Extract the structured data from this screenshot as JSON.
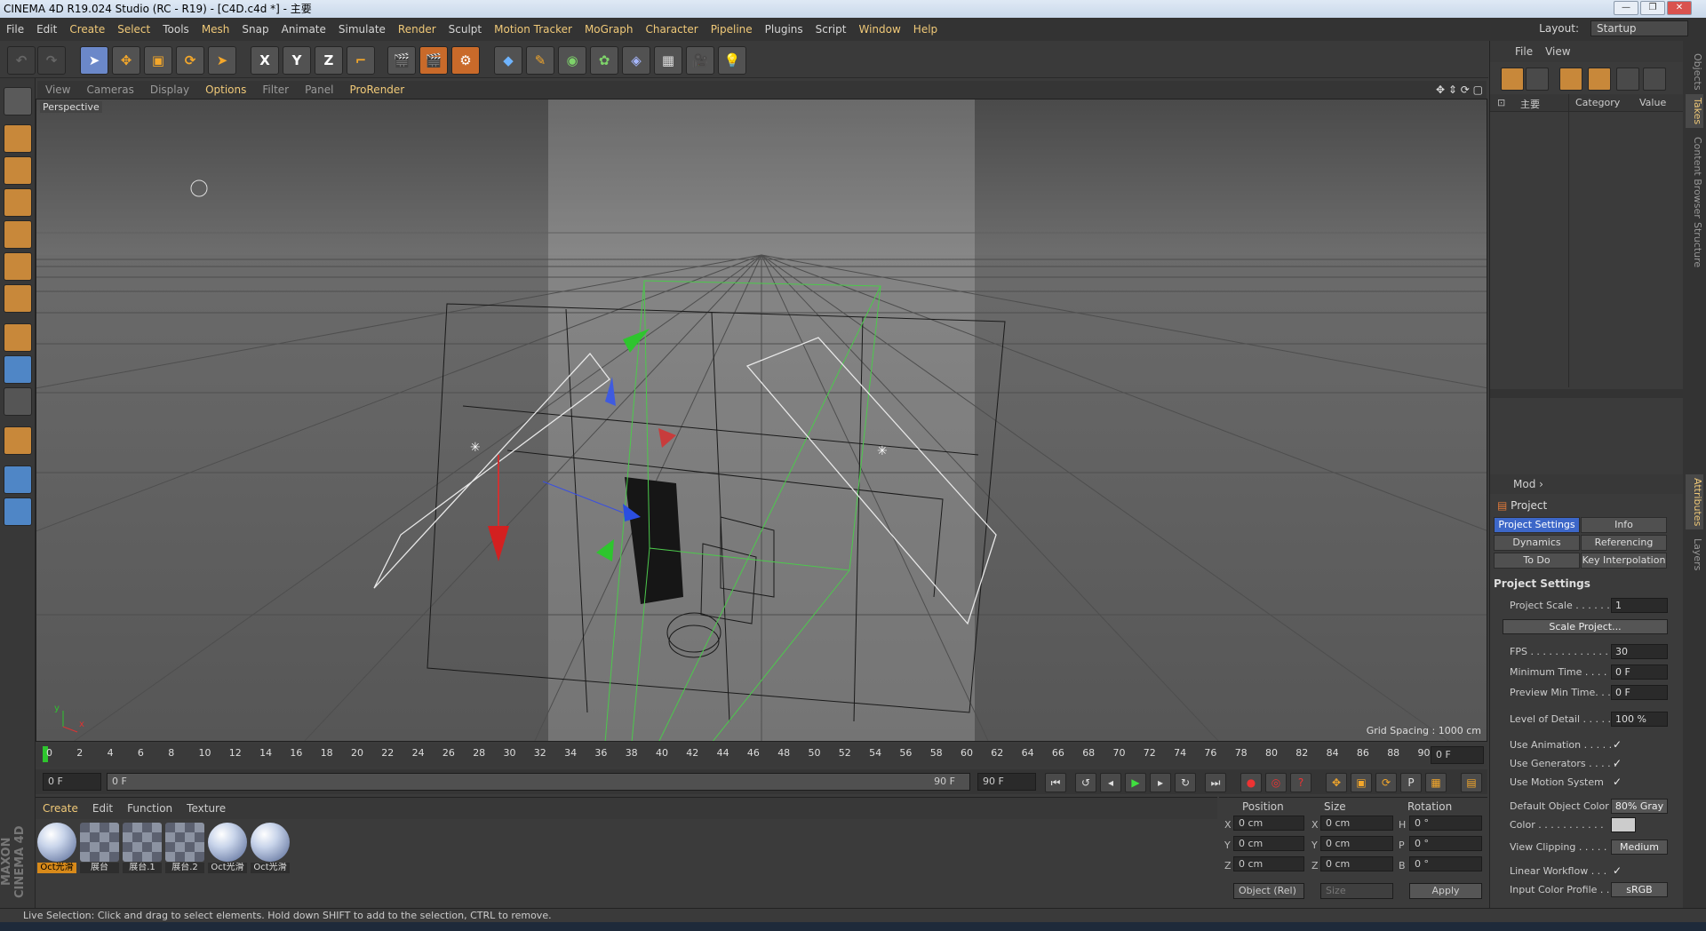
{
  "window": {
    "title": "CINEMA 4D R19.024 Studio (RC - R19) - [C4D.c4d *] - 主要",
    "layout_label": "Layout:",
    "layout_value": "Startup",
    "buttons": [
      "—",
      "❐",
      "✕"
    ]
  },
  "menubar": [
    "File",
    "Edit",
    "Create",
    "Select",
    "Tools",
    "Mesh",
    "Snap",
    "Animate",
    "Simulate",
    "Render",
    "Sculpt",
    "Motion Tracker",
    "MoGraph",
    "Character",
    "Pipeline",
    "Plugins",
    "Script",
    "Window",
    "Help"
  ],
  "toolbar": {
    "axis_labels": [
      "X",
      "Y",
      "Z"
    ]
  },
  "viewport": {
    "menu": [
      "View",
      "Cameras",
      "Display",
      "Options",
      "Filter",
      "Panel",
      "ProRender"
    ],
    "active_menu": "Options",
    "name": "Perspective",
    "grid_spacing": "Grid Spacing : 1000 cm",
    "axis_y": "y",
    "axis_x": "x"
  },
  "timeline": {
    "ticks": [
      "0",
      "2",
      "4",
      "6",
      "8",
      "10",
      "12",
      "14",
      "16",
      "18",
      "20",
      "22",
      "24",
      "26",
      "28",
      "30",
      "32",
      "34",
      "36",
      "38",
      "40",
      "42",
      "44",
      "46",
      "48",
      "50",
      "52",
      "54",
      "56",
      "58",
      "60",
      "62",
      "64",
      "66",
      "68",
      "70",
      "72",
      "74",
      "76",
      "78",
      "80",
      "82",
      "84",
      "86",
      "88",
      "90"
    ],
    "current_frame": "0 F",
    "start_field": "0 F",
    "range_start": "0 F",
    "range_end": "90 F",
    "end_field": "90 F"
  },
  "materials": {
    "menu": [
      "Create",
      "Edit",
      "Function",
      "Texture"
    ],
    "items": [
      {
        "label": "Oct光滑",
        "kind": "ball",
        "selected": true
      },
      {
        "label": "展台",
        "kind": "checker",
        "selected": false
      },
      {
        "label": "展台.1",
        "kind": "checker",
        "selected": false
      },
      {
        "label": "展台.2",
        "kind": "checker",
        "selected": false
      },
      {
        "label": "Oct光滑",
        "kind": "ball",
        "selected": false
      },
      {
        "label": "Oct光滑",
        "kind": "ball",
        "selected": false
      }
    ],
    "brand": "MAXON CINEMA 4D"
  },
  "coordinates": {
    "headers": [
      "Position",
      "Size",
      "Rotation"
    ],
    "rows": [
      {
        "a1": "X",
        "v1": "0 cm",
        "a2": "X",
        "v2": "0 cm",
        "a3": "H",
        "v3": "0 °"
      },
      {
        "a1": "Y",
        "v1": "0 cm",
        "a2": "Y",
        "v2": "0 cm",
        "a3": "P",
        "v3": "0 °"
      },
      {
        "a1": "Z",
        "v1": "0 cm",
        "a2": "Z",
        "v2": "0 cm",
        "a3": "B",
        "v3": "0 °"
      }
    ],
    "mode": "Object (Rel)",
    "size_mode": "Size",
    "apply": "Apply"
  },
  "status": "Live Selection: Click and drag to select elements. Hold down SHIFT to add to the selection, CTRL to remove.",
  "objects_panel": {
    "menu": [
      "File",
      "View"
    ],
    "take_name": "主要",
    "columns": [
      "Category",
      "Value"
    ]
  },
  "attributes": {
    "mode_label": "Mod",
    "object": "Project",
    "tabs": [
      "Project Settings",
      "Info",
      "Dynamics",
      "Referencing",
      "To Do",
      "Key Interpolation"
    ],
    "section": "Project Settings",
    "rows": [
      {
        "label": "Project Scale . . . . . .",
        "value": "1"
      },
      {
        "label": "Scale Project...",
        "value": ""
      },
      {
        "label": "FPS . . . . . . . . . . . . . .",
        "value": "30"
      },
      {
        "label": "Minimum Time . . . . .",
        "value": "0 F"
      },
      {
        "label": "Preview Min Time. . .",
        "value": "0 F"
      },
      {
        "label": "Level of Detail . . . . .",
        "value": "100 %"
      },
      {
        "label": "Use Animation . . . . .",
        "value": "✓"
      },
      {
        "label": "Use Generators . . . . .",
        "value": "✓"
      },
      {
        "label": "Use Motion System",
        "value": "✓"
      },
      {
        "label": "Default Object Color",
        "value": "80% Gray"
      },
      {
        "label": "Color . . . . . . . . . . .",
        "value": ""
      },
      {
        "label": "View Clipping . . . . .",
        "value": "Medium"
      },
      {
        "label": "Linear Workflow . . .",
        "value": "✓"
      },
      {
        "label": "Input Color Profile . .",
        "value": "sRGB"
      }
    ]
  },
  "side_tabs": [
    "Objects",
    "Takes",
    "Content Browser",
    "Structure",
    "Attributes",
    "Layers"
  ]
}
